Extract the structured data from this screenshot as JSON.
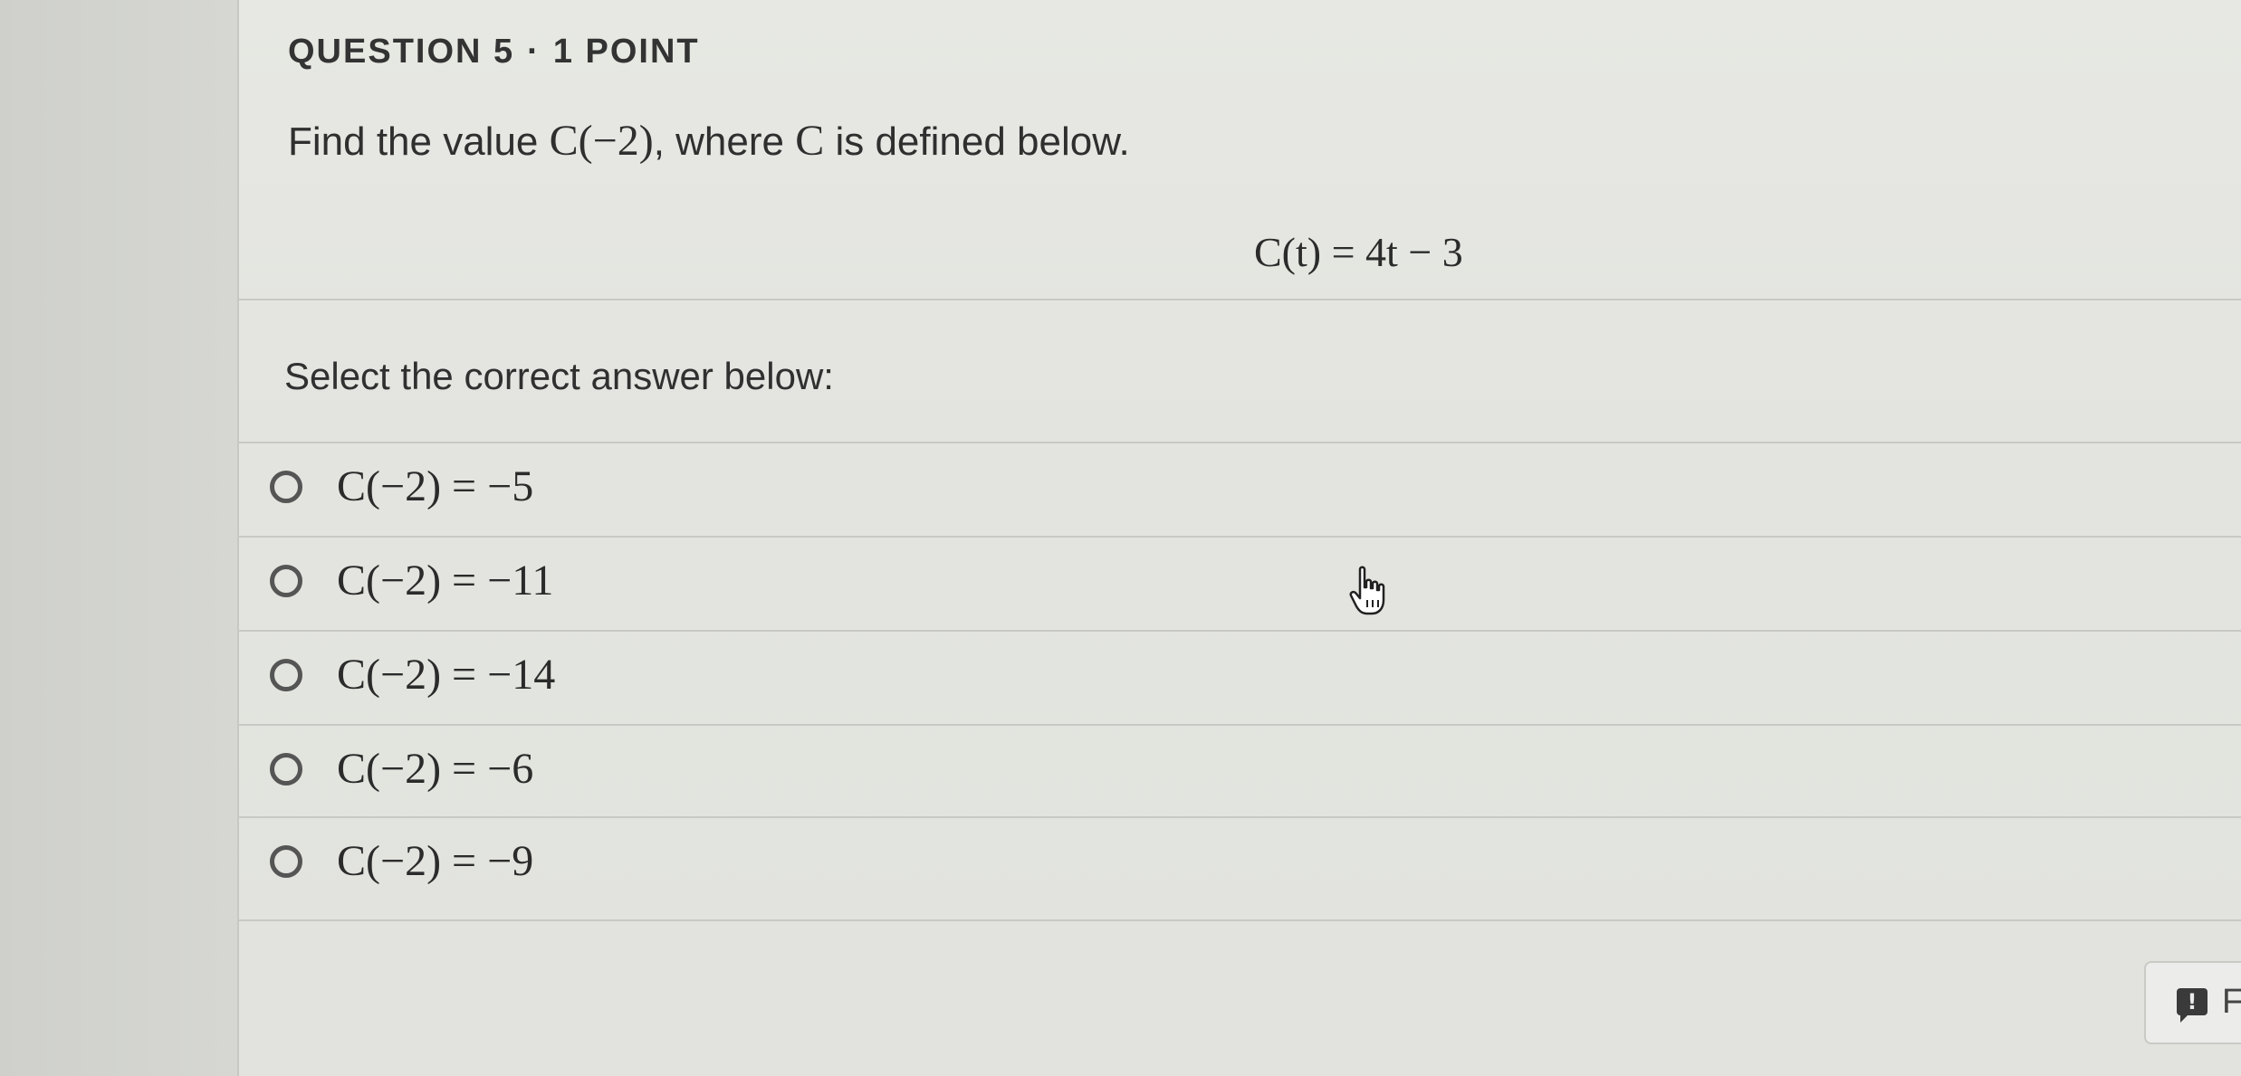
{
  "question": {
    "number_label": "QUESTION 5",
    "separator": "·",
    "points_label": "1 POINT",
    "prompt_prefix": "Find the value ",
    "prompt_value": "C(−2)",
    "prompt_middle": ", where ",
    "prompt_symbol": "C",
    "prompt_suffix": " is defined below.",
    "definition": "C(t) = 4t − 3",
    "instruction": "Select the correct answer below:"
  },
  "options": [
    {
      "label": "C(−2) = −5",
      "selected": false
    },
    {
      "label": "C(−2) = −11",
      "selected": false
    },
    {
      "label": "C(−2) = −14",
      "selected": false
    },
    {
      "label": "C(−2) = −6",
      "selected": false
    },
    {
      "label": "C(−2) = −9",
      "selected": false
    }
  ],
  "icons": {
    "pointer": "hand-pointer-icon",
    "feedback": "feedback-icon"
  },
  "feedback": {
    "icon_glyph": "!",
    "label": "F"
  },
  "colors": {
    "background": "#e5e6e1",
    "radio_border": "#555555",
    "text": "#2e2e2e",
    "divider": "#c8c9c4"
  }
}
